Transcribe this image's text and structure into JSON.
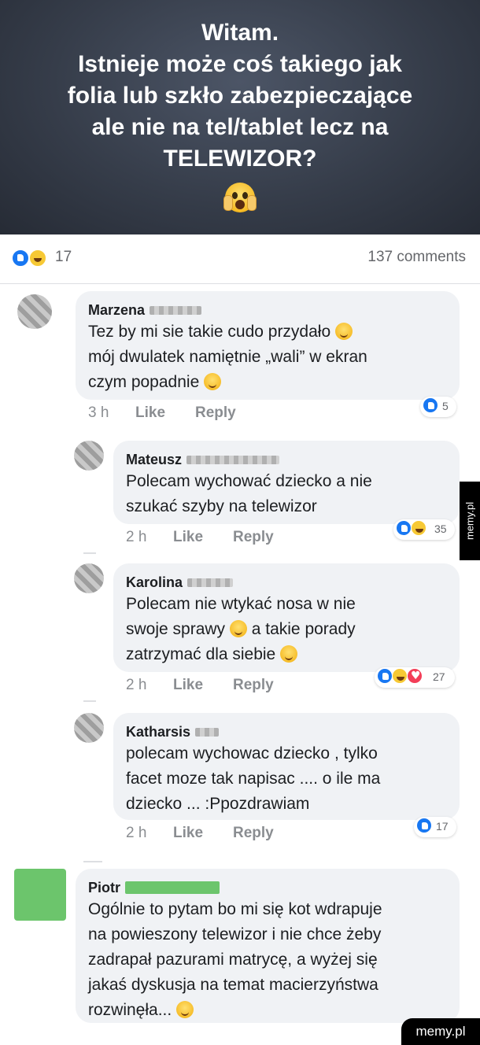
{
  "post": {
    "lines": [
      "Witam.",
      "Istnieje może coś takiego jak",
      "folia lub szkło zabezpieczające",
      "ale nie na tel/tablet lecz na",
      "TELEWIZOR?"
    ],
    "emoji": "screaming-face-icon"
  },
  "summary": {
    "reaction_count": "17",
    "comments": "137 comments"
  },
  "comments": [
    {
      "author": "Marzena",
      "lines": [
        "Tez by mi sie takie cudo przydało",
        "mój dwulatek namiętnie „wali” w ekran",
        "czym popadnie"
      ],
      "time": "3 h",
      "like": "Like",
      "reply": "Reply",
      "reactions": "5"
    },
    {
      "author": "Mateusz",
      "lines": [
        "Polecam wychować dziecko a nie",
        "szukać szyby na telewizor"
      ],
      "time": "2 h",
      "like": "Like",
      "reply": "Reply",
      "reactions": "35"
    },
    {
      "author": "Karolina",
      "lines": [
        "Polecam nie wtykać nosa w nie",
        "swoje sprawy",
        "a takie porady",
        "zatrzymać dla siebie"
      ],
      "time": "2 h",
      "like": "Like",
      "reply": "Reply",
      "reactions": "27"
    },
    {
      "author": "Katharsis",
      "lines": [
        "polecam wychowac dziecko , tylko",
        "facet moze tak napisac .... o ile ma",
        "dziecko ... :Ppozdrawiam"
      ],
      "time": "2 h",
      "like": "Like",
      "reply": "Reply",
      "reactions": "17"
    },
    {
      "author": "Piotr",
      "lines": [
        "Ogólnie to pytam bo mi się kot wdrapuje",
        "na powieszony telewizor i nie chce żeby",
        "zadrapał pazurami matrycę, a wyżej się",
        "jakaś dyskusja na temat macierzyństwa",
        "rozwinęła..."
      ]
    }
  ],
  "watermark": {
    "side": "memy.pl",
    "corner": "memy.pl"
  },
  "colors": {
    "like_blue": "#1877f2",
    "haha_yellow": "#f7c935",
    "love_red": "#f33e58",
    "bubble": "#f0f2f5"
  }
}
